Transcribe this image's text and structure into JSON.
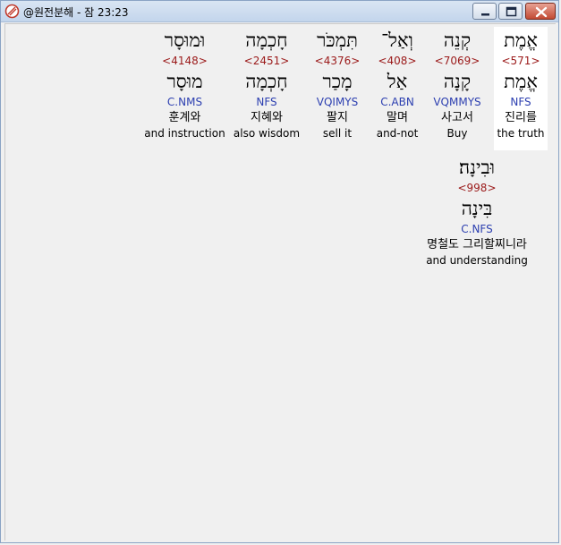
{
  "window": {
    "title": "@원전분해 - 잠 23:23"
  },
  "words": [
    {
      "surface": "אֱמֶת",
      "strong": "<571>",
      "lemma": "אֱמֶת",
      "parse": "NFS",
      "korean": "진리를",
      "english": "the truth",
      "highlighted": true
    },
    {
      "surface": "קְנֵה",
      "strong": "<7069>",
      "lemma": "קָנָה",
      "parse": "VQMMYS",
      "korean": "사고서",
      "english": "Buy"
    },
    {
      "surface": "וְאַל־",
      "strong": "<408>",
      "lemma": "אַל",
      "parse": "C.ABN",
      "korean": "말며",
      "english": "and-not"
    },
    {
      "surface": "תִּמְכֹּר",
      "strong": "<4376>",
      "lemma": "מָכַר",
      "parse": "VQIMYS",
      "korean": "팔지",
      "english": "sell it"
    },
    {
      "surface": "חָכְמָה",
      "strong": "<2451>",
      "lemma": "חָכְמָה",
      "parse": "NFS",
      "korean": "지혜와",
      "english": "also wisdom"
    },
    {
      "surface": "וּמוּסָר",
      "strong": "<4148>",
      "lemma": "מוּסָר",
      "parse": "C.NMS",
      "korean": "훈계와",
      "english": "and instruction"
    },
    {
      "surface": "וּבִינָה׃",
      "strong": "<998>",
      "lemma": "בִּינָה",
      "parse": "C.NFS",
      "korean": "명철도 그리할찌니라",
      "english": "and understanding"
    }
  ]
}
